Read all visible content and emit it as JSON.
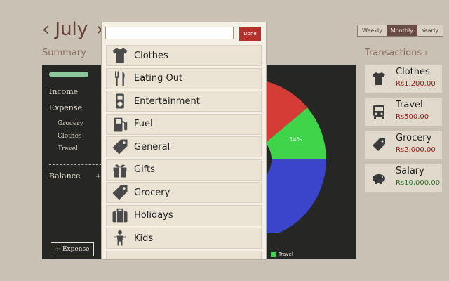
{
  "header": {
    "month": "July",
    "prev_icon": "chevron-left-icon",
    "next_icon": "chevron-right-icon"
  },
  "summary": {
    "label": "Summary",
    "progress_fraction": 0.7,
    "income_label": "Income",
    "expense_label": "Expense",
    "expense_items": [
      "Grocery",
      "Clothes",
      "Travel"
    ],
    "balance_label": "Balance",
    "balance_glyph": "+",
    "add_expense_label": "+ Expense",
    "chart_data": {
      "type": "pie",
      "slices": [
        {
          "label": "",
          "value": 14,
          "color": "#3fd44a",
          "value_label": "14%"
        },
        {
          "label": "",
          "value": 8,
          "color": "#d63c36"
        },
        {
          "label": "",
          "value": 36,
          "color": "#3b45cc"
        }
      ],
      "legend": [
        {
          "label": "Travel",
          "color": "#3fd44a"
        }
      ]
    }
  },
  "period": {
    "options": [
      "Weekly",
      "Monthly",
      "Yearly"
    ],
    "selected": "Monthly"
  },
  "transactions": {
    "label": "Transactions",
    "label_icon": "chevron-right-icon",
    "items": [
      {
        "name": "Clothes",
        "amount": "Rs1,200.00",
        "icon": "tshirt-icon",
        "type": "expense"
      },
      {
        "name": "Travel",
        "amount": "Rs500.00",
        "icon": "bus-icon",
        "type": "expense"
      },
      {
        "name": "Grocery",
        "amount": "Rs2,000.00",
        "icon": "tag-icon",
        "type": "expense"
      },
      {
        "name": "Salary",
        "amount": "Rs10,000.00",
        "icon": "piggy-bank-icon",
        "type": "income"
      }
    ]
  },
  "popup": {
    "search_value": "",
    "done_label": "Done",
    "categories": [
      {
        "label": "Clothes",
        "icon": "tshirt-icon"
      },
      {
        "label": "Eating Out",
        "icon": "fork-knife-icon"
      },
      {
        "label": "Entertainment",
        "icon": "ipod-icon"
      },
      {
        "label": "Fuel",
        "icon": "fuel-pump-icon"
      },
      {
        "label": "General",
        "icon": "tag-icon"
      },
      {
        "label": "Gifts",
        "icon": "gift-icon"
      },
      {
        "label": "Grocery",
        "icon": "tag-icon"
      },
      {
        "label": "Holidays",
        "icon": "suitcase-icon"
      },
      {
        "label": "Kids",
        "icon": "child-icon"
      }
    ]
  }
}
